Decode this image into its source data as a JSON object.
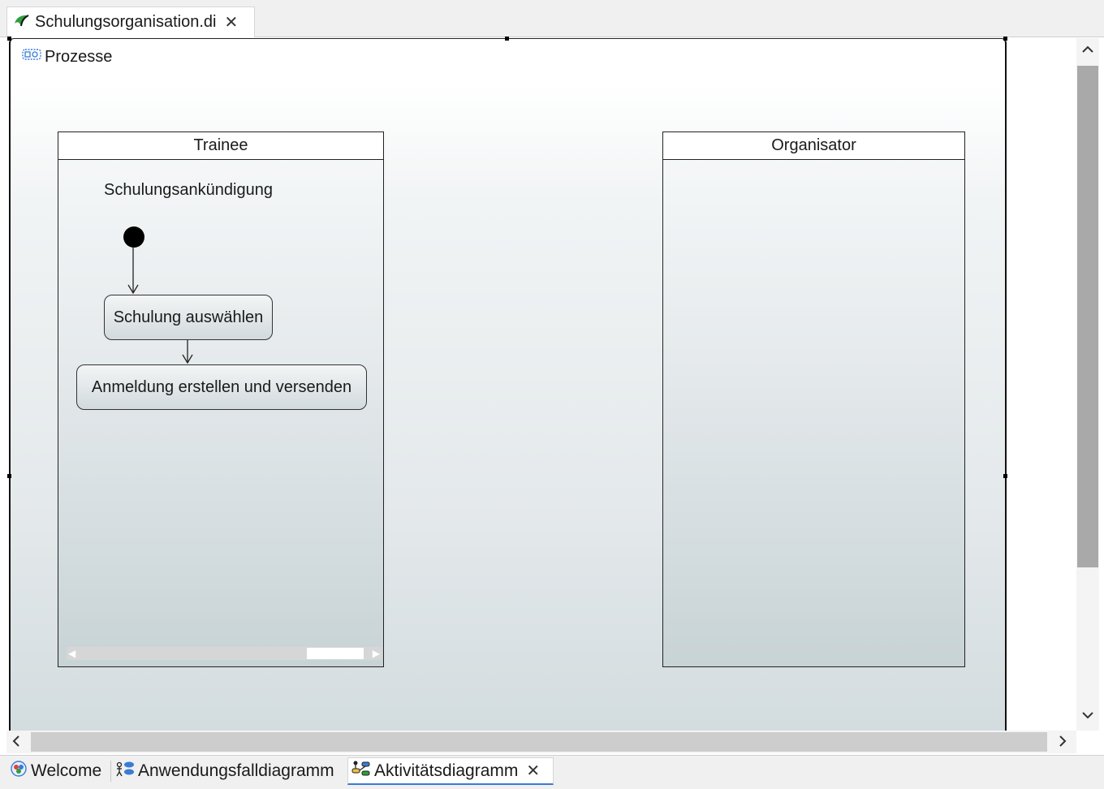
{
  "editor": {
    "tab_label": "Schulungsorganisation.di",
    "close_glyph": "✕",
    "tab_icon": "papyrus-leaf-icon"
  },
  "diagram": {
    "title": "Prozesse",
    "title_icon": "activity-container-icon",
    "lanes": [
      {
        "name": "Trainee"
      },
      {
        "name": "Organisator"
      }
    ],
    "partition_label": "Schulungsankündigung",
    "actions": [
      {
        "label": "Schulung auswählen"
      },
      {
        "label": "Anmeldung erstellen und versenden"
      }
    ]
  },
  "scrollbars": {
    "up": "⌃",
    "down": "⌄",
    "left": "‹",
    "right": "›"
  },
  "bottom_tabs": [
    {
      "label": "Welcome",
      "icon": "welcome-icon"
    },
    {
      "label": "Anwendungsfalldiagramm",
      "icon": "use-case-diagram-icon"
    },
    {
      "label": "Aktivitätsdiagramm",
      "icon": "activity-diagram-icon",
      "active": true,
      "close_glyph": "✕"
    }
  ],
  "colors": {
    "active_tab_underline": "#3a7bd5",
    "initial_node": "#000000",
    "lane_border": "#222222"
  }
}
